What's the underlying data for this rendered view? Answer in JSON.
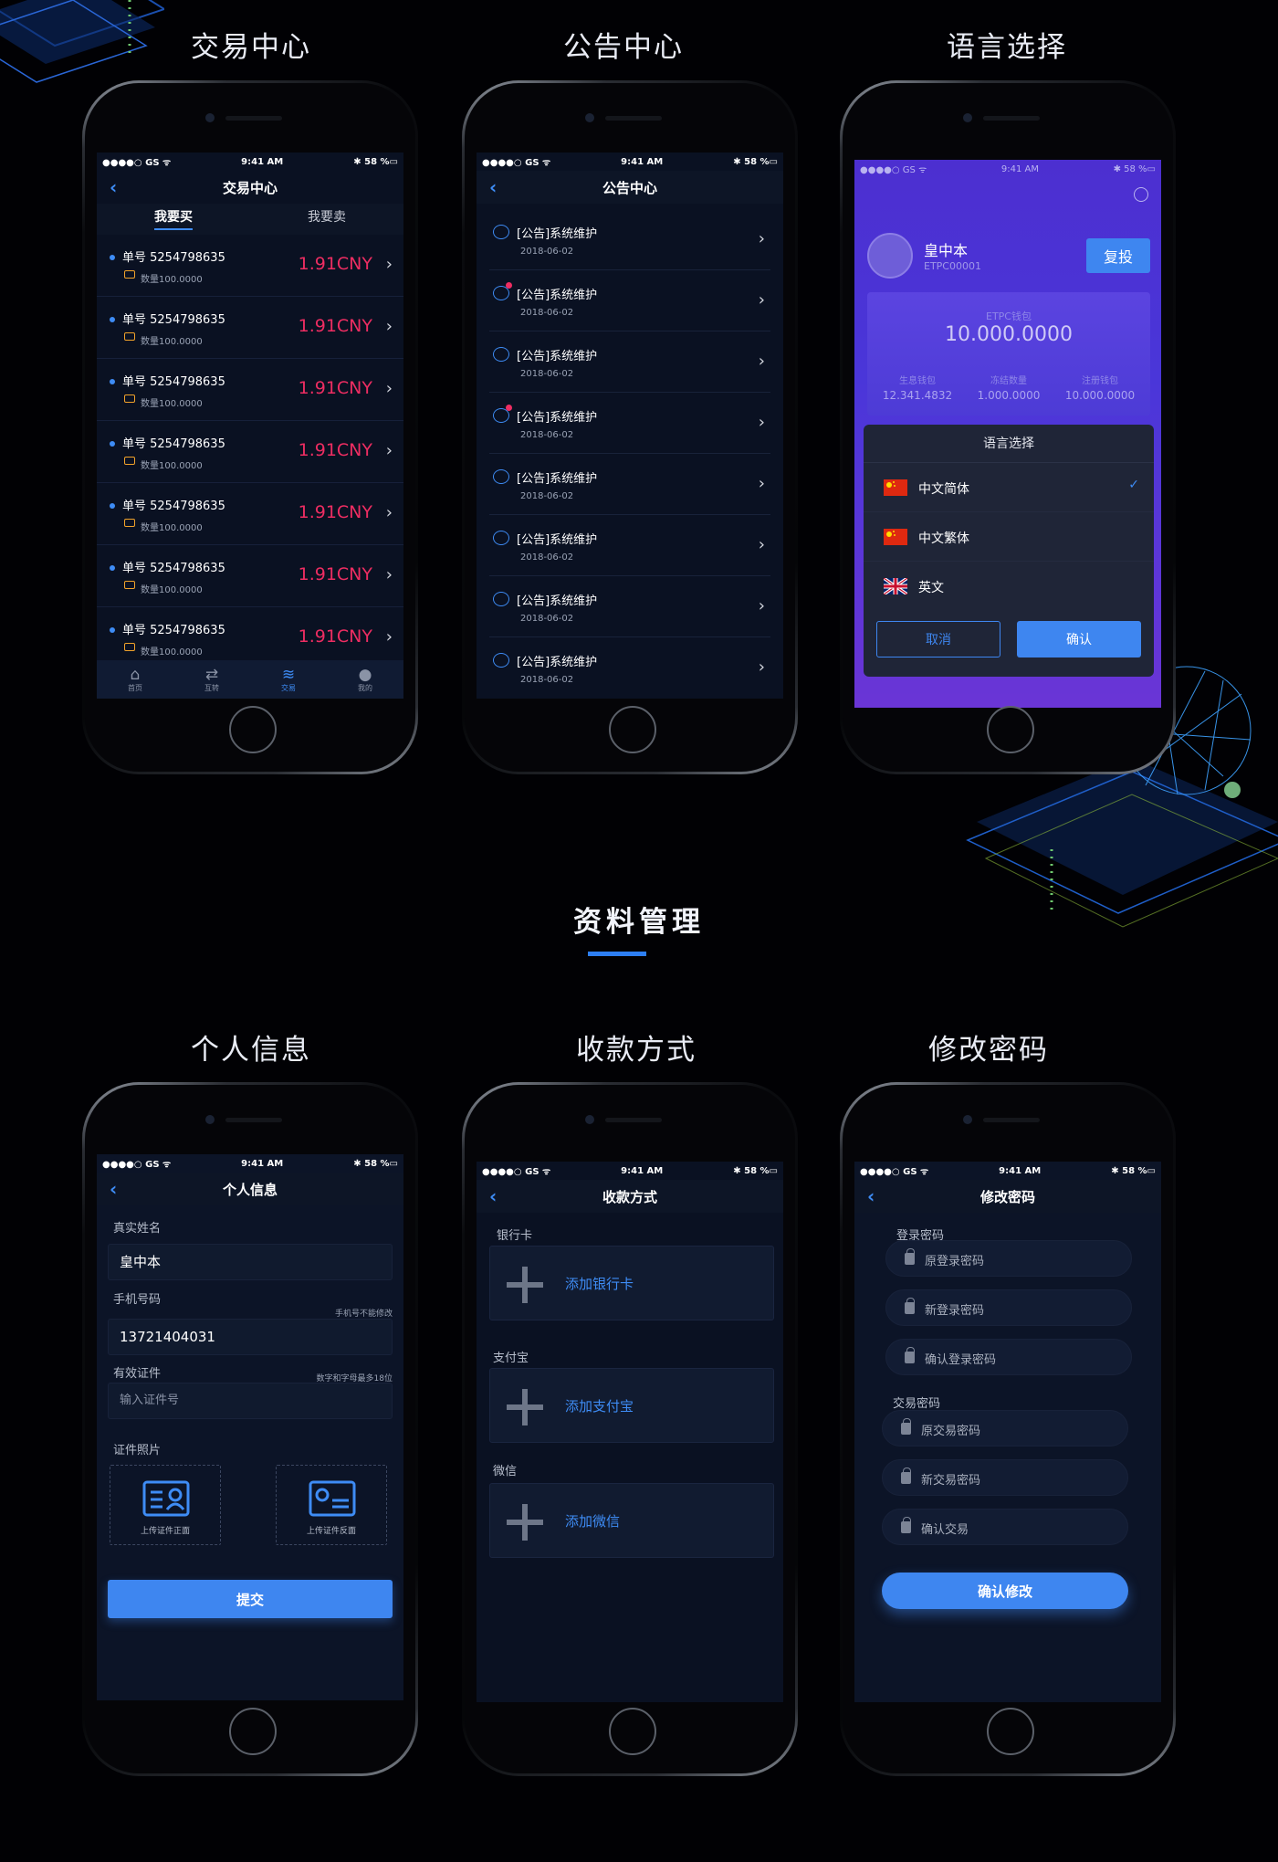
{
  "sections": {
    "trade_title": "交易中心",
    "notice_title": "公告中心",
    "lang_title": "语言选择",
    "middle_title": "资料管理",
    "personal_title": "个人信息",
    "payment_title": "收款方式",
    "password_title": "修改密码"
  },
  "status": {
    "carrier": "●●●●○ GS ᯤ",
    "time": "9:41 AM",
    "battery": "✱ 58 %▭"
  },
  "trade": {
    "nav_title": "交易中心",
    "tabs": [
      "我要买",
      "我要卖"
    ],
    "rows": [
      {
        "no": "单号 5254798635",
        "qty": "数量100.0000",
        "price": "1.91CNY"
      },
      {
        "no": "单号 5254798635",
        "qty": "数量100.0000",
        "price": "1.91CNY"
      },
      {
        "no": "单号 5254798635",
        "qty": "数量100.0000",
        "price": "1.91CNY"
      },
      {
        "no": "单号 5254798635",
        "qty": "数量100.0000",
        "price": "1.91CNY"
      },
      {
        "no": "单号 5254798635",
        "qty": "数量100.0000",
        "price": "1.91CNY"
      },
      {
        "no": "单号 5254798635",
        "qty": "数量100.0000",
        "price": "1.91CNY"
      },
      {
        "no": "单号 5254798635",
        "qty": "数量100.0000",
        "price": "1.91CNY"
      }
    ],
    "tabbar": [
      "首页",
      "互转",
      "交易",
      "我的"
    ]
  },
  "notice": {
    "nav_title": "公告中心",
    "rows": [
      {
        "title": "[公告]系统维护",
        "date": "2018-06-02"
      },
      {
        "title": "[公告]系统维护",
        "date": "2018-06-02"
      },
      {
        "title": "[公告]系统维护",
        "date": "2018-06-02"
      },
      {
        "title": "[公告]系统维护",
        "date": "2018-06-02"
      },
      {
        "title": "[公告]系统维护",
        "date": "2018-06-02"
      },
      {
        "title": "[公告]系统维护",
        "date": "2018-06-02"
      },
      {
        "title": "[公告]系统维护",
        "date": "2018-06-02"
      },
      {
        "title": "[公告]系统维护",
        "date": "2018-06-02"
      }
    ]
  },
  "lang": {
    "name": "皇中本",
    "id": "ETPC00001",
    "copy_label": "复投",
    "wallet_label": "ETPC钱包",
    "wallet_value": "10.000.0000",
    "sub_labels": [
      "生息钱包",
      "冻结数量",
      "注册钱包"
    ],
    "sub_values": [
      "12.341.4832",
      "1.000.0000",
      "10.000.0000"
    ],
    "dialog_title": "语言选择",
    "options": [
      "中文简体",
      "中文繁体",
      "英文"
    ],
    "cancel": "取消",
    "ok": "确认"
  },
  "personal": {
    "nav_title": "个人信息",
    "name_label": "真实姓名",
    "name_value": "皇中本",
    "phone_label": "手机号码",
    "phone_hint": "手机号不能修改",
    "phone_value": "13721404031",
    "id_label": "有效证件",
    "id_hint": "数字和字母最多18位",
    "id_placeholder": "输入证件号",
    "photo_label": "证件照片",
    "front": "上传证件正面",
    "back": "上传证件反面",
    "submit": "提交"
  },
  "payment": {
    "nav_title": "收款方式",
    "bank_label": "银行卡",
    "bank_add": "添加银行卡",
    "alipay_label": "支付宝",
    "alipay_add": "添加支付宝",
    "wechat_label": "微信",
    "wechat_add": "添加微信"
  },
  "password": {
    "nav_title": "修改密码",
    "login_label": "登录密码",
    "login_fields": [
      "原登录密码",
      "新登录密码",
      "确认登录密码"
    ],
    "trade_label": "交易密码",
    "trade_fields": [
      "原交易密码",
      "新交易密码",
      "确认交易"
    ],
    "confirm": "确认修改"
  }
}
